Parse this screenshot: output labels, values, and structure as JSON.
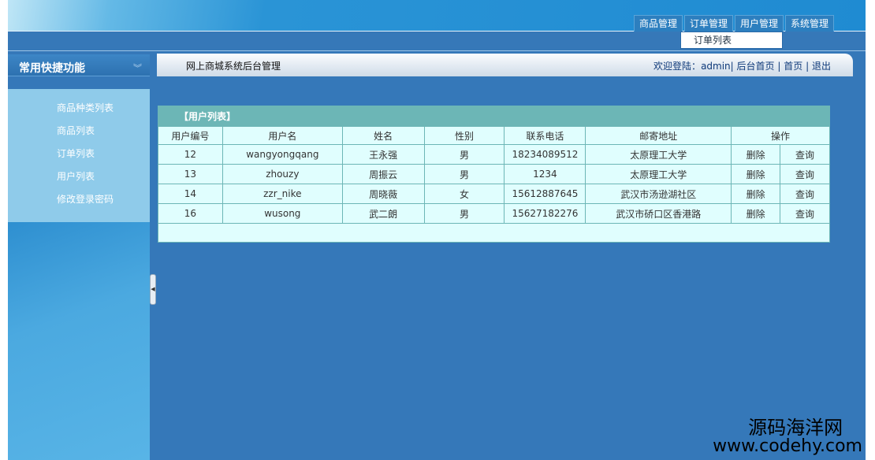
{
  "topnav": {
    "tabs": [
      "商品管理",
      "订单管理",
      "用户管理",
      "系统管理"
    ],
    "dropdown_item": "订单列表"
  },
  "sidebar": {
    "title": "常用快捷功能",
    "collapse_icon": "︾",
    "items": [
      "商品种类列表",
      "商品列表",
      "订单列表",
      "用户列表",
      "修改登录密码"
    ]
  },
  "titlebar": {
    "title": "网上商城系统后台管理",
    "welcome": "欢迎登陆：",
    "user": "admin",
    "sep": "|",
    "links": [
      "后台首页",
      "首页",
      "退出"
    ]
  },
  "table": {
    "caption": "【用户列表】",
    "headers": [
      "用户编号",
      "用户名",
      "姓名",
      "性别",
      "联系电话",
      "邮寄地址",
      "操作"
    ],
    "rows": [
      {
        "id": "12",
        "username": "wangyongqang",
        "name": "王永强",
        "gender": "男",
        "phone": "18234089512",
        "address": "太原理工大学",
        "del": "删除",
        "query": "查询"
      },
      {
        "id": "13",
        "username": "zhouzy",
        "name": "周振云",
        "gender": "男",
        "phone": "1234",
        "address": "太原理工大学",
        "del": "删除",
        "query": "查询"
      },
      {
        "id": "14",
        "username": "zzr_nike",
        "name": "周晓薇",
        "gender": "女",
        "phone": "15612887645",
        "address": "武汉市汤逊湖社区",
        "del": "删除",
        "query": "查询"
      },
      {
        "id": "16",
        "username": "wusong",
        "name": "武二朗",
        "gender": "男",
        "phone": "15627182276",
        "address": "武汉市硚口区香港路",
        "del": "删除",
        "query": "查询"
      }
    ]
  },
  "watermark": {
    "line1": "源码海洋网",
    "line2": "www.codehy.com"
  }
}
